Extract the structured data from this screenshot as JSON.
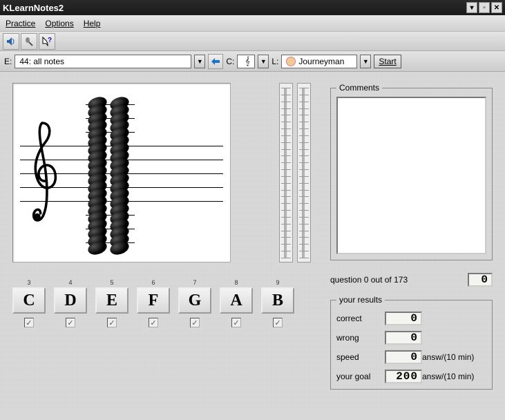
{
  "window": {
    "title": "KLearnNotes2"
  },
  "menu": {
    "practice": "Practice",
    "options": "Options",
    "help": "Help"
  },
  "config": {
    "e_label": "E:",
    "exercise_selected": "44: all notes",
    "c_label": "C:",
    "l_label": "L:",
    "level_selected": "Journeyman",
    "start_label": "Start"
  },
  "notes": {
    "buttons": [
      {
        "label": "C",
        "super": "3"
      },
      {
        "label": "D",
        "super": "4"
      },
      {
        "label": "E",
        "super": "5"
      },
      {
        "label": "F",
        "super": "6"
      },
      {
        "label": "G",
        "super": "7"
      },
      {
        "label": "A",
        "super": "8"
      },
      {
        "label": "B",
        "super": "9"
      }
    ]
  },
  "comments_legend": "Comments",
  "question": {
    "prefix": "question ",
    "current": 0,
    "sep": " out of ",
    "total": 173,
    "counter": "0"
  },
  "results": {
    "legend": "your results",
    "rows": {
      "correct": {
        "label": "correct",
        "value": "0",
        "unit": ""
      },
      "wrong": {
        "label": "wrong",
        "value": "0",
        "unit": ""
      },
      "speed": {
        "label": "speed",
        "value": "0",
        "unit": "answ/(10 min)"
      },
      "goal": {
        "label": "your goal",
        "value": "200",
        "unit": "answ/(10 min)"
      }
    }
  }
}
